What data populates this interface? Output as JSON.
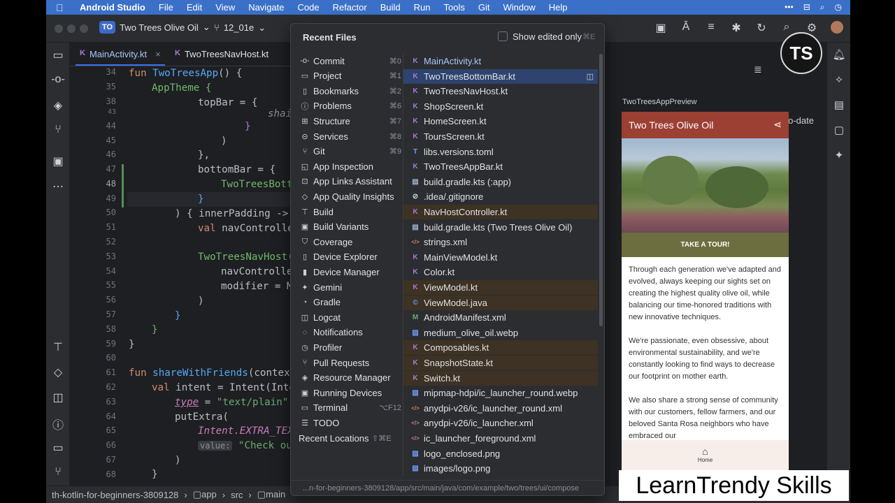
{
  "menubar": {
    "app_name": "Android Studio",
    "items": [
      "File",
      "Edit",
      "View",
      "Navigate",
      "Code",
      "Refactor",
      "Build",
      "Run",
      "Tools",
      "Git",
      "Window",
      "Help"
    ]
  },
  "titlebar": {
    "project_badge": "TO",
    "project_name": "Two Trees Olive Oil",
    "branch": "12_01e"
  },
  "editor": {
    "tabs": [
      {
        "label": "MainActivity.kt",
        "icon": "kotlin-file-icon"
      },
      {
        "label": "TwoTreesNavHost.kt",
        "icon": "kotlin-file-icon"
      }
    ],
    "line_numbers": [
      "34",
      "35",
      "38",
      "43",
      "44",
      "45",
      "46",
      "47",
      "48",
      "49",
      "50",
      "51",
      "52",
      "53",
      "54",
      "55",
      "56",
      "57",
      "58",
      "59",
      "60",
      "61",
      "62",
      "63",
      "64",
      "65",
      "66",
      "67",
      "68"
    ],
    "code": {
      "l34_kw": "fun ",
      "l34_fn": "TwoTreesApp",
      "l34_rest": "() {",
      "l35": "AppTheme {",
      "l38": "topBar = {",
      "l43": "shai",
      "l44": "}",
      "l45": ")",
      "l46": "},",
      "l47": "bottomBar = {",
      "l48": "TwoTreesBott",
      "l49": "}",
      "l50": ") { innerPadding ->",
      "l51_kw": "val ",
      "l51_rest": "navControlle",
      "l53": "TwoTreesNavHost(",
      "l54": "navControlle",
      "l55": "modifier = M",
      "l56": ")",
      "l57": "}",
      "l58": "}",
      "l59": "}",
      "l61_kw": "fun ",
      "l61_fn": "shareWithFriends",
      "l61_rest": "(context",
      "l62_kw": "val ",
      "l62_rest": "intent = Intent(Inte",
      "l63_type": "type",
      "l63_eq": " = ",
      "l63_str": "\"text/plain\"",
      "l64": "putExtra(",
      "l65": "Intent.EXTRA_TEX",
      "l66_hint": "value:",
      "l66_str": " \"Check out",
      "l67": ")",
      "l68": "}"
    }
  },
  "popup": {
    "title": "Recent Files",
    "show_edited_label": "Show edited only",
    "show_edited_hint": "⌘E",
    "tool_windows": [
      {
        "label": "Commit",
        "shortcut": "⌘0",
        "icon": "commit-icon"
      },
      {
        "label": "Project",
        "shortcut": "⌘1",
        "icon": "folder-icon"
      },
      {
        "label": "Bookmarks",
        "shortcut": "⌘2",
        "icon": "bookmark-icon"
      },
      {
        "label": "Problems",
        "shortcut": "⌘6",
        "icon": "problems-icon"
      },
      {
        "label": "Structure",
        "shortcut": "⌘7",
        "icon": "structure-icon"
      },
      {
        "label": "Services",
        "shortcut": "⌘8",
        "icon": "services-icon"
      },
      {
        "label": "Git",
        "shortcut": "⌘9",
        "icon": "git-icon"
      },
      {
        "label": "App Inspection",
        "shortcut": "",
        "icon": "app-inspection-icon"
      },
      {
        "label": "App Links Assistant",
        "shortcut": "",
        "icon": "link-icon"
      },
      {
        "label": "App Quality Insights",
        "shortcut": "",
        "icon": "diamond-icon"
      },
      {
        "label": "Build",
        "shortcut": "",
        "icon": "build-icon"
      },
      {
        "label": "Build Variants",
        "shortcut": "",
        "icon": "build-variants-icon"
      },
      {
        "label": "Coverage",
        "shortcut": "",
        "icon": "shield-icon"
      },
      {
        "label": "Device Explorer",
        "shortcut": "",
        "icon": "device-icon"
      },
      {
        "label": "Device Manager",
        "shortcut": "",
        "icon": "device-manager-icon"
      },
      {
        "label": "Gemini",
        "shortcut": "",
        "icon": "sparkle-icon"
      },
      {
        "label": "Gradle",
        "shortcut": "",
        "icon": "gradle-icon"
      },
      {
        "label": "Logcat",
        "shortcut": "",
        "icon": "logcat-icon"
      },
      {
        "label": "Notifications",
        "shortcut": "",
        "icon": "bell-icon"
      },
      {
        "label": "Profiler",
        "shortcut": "",
        "icon": "profiler-icon"
      },
      {
        "label": "Pull Requests",
        "shortcut": "",
        "icon": "pull-request-icon"
      },
      {
        "label": "Resource Manager",
        "shortcut": "",
        "icon": "resource-icon"
      },
      {
        "label": "Running Devices",
        "shortcut": "",
        "icon": "running-devices-icon"
      },
      {
        "label": "Terminal",
        "shortcut": "⌥F12",
        "icon": "terminal-icon"
      },
      {
        "label": "TODO",
        "shortcut": "",
        "icon": "list-icon"
      }
    ],
    "recent_locations_label": "Recent Locations",
    "recent_locations_shortcut": "⇧⌘E",
    "files": [
      {
        "name": "MainActivity.kt",
        "type": "kt",
        "state": "current"
      },
      {
        "name": "TwoTreesBottomBar.kt",
        "type": "kt",
        "state": "selected"
      },
      {
        "name": "TwoTreesNavHost.kt",
        "type": "kt",
        "state": ""
      },
      {
        "name": "ShopScreen.kt",
        "type": "kt",
        "state": ""
      },
      {
        "name": "HomeScreen.kt",
        "type": "kt",
        "state": ""
      },
      {
        "name": "ToursScreen.kt",
        "type": "kt",
        "state": ""
      },
      {
        "name": "libs.versions.toml",
        "type": "toml",
        "state": ""
      },
      {
        "name": "TwoTreesAppBar.kt",
        "type": "kt",
        "state": ""
      },
      {
        "name": "build.gradle.kts (:app)",
        "type": "gr",
        "state": ""
      },
      {
        "name": ".idea/.gitignore",
        "type": "git",
        "state": ""
      },
      {
        "name": "NavHostController.kt",
        "type": "kt",
        "state": "modified"
      },
      {
        "name": "build.gradle.kts (Two Trees Olive Oil)",
        "type": "gr",
        "state": ""
      },
      {
        "name": "strings.xml",
        "type": "xml",
        "state": ""
      },
      {
        "name": "MainViewModel.kt",
        "type": "kt",
        "state": ""
      },
      {
        "name": "Color.kt",
        "type": "kt",
        "state": ""
      },
      {
        "name": "ViewModel.kt",
        "type": "kt",
        "state": "modified"
      },
      {
        "name": "ViewModel.java",
        "type": "java",
        "state": "modified"
      },
      {
        "name": "AndroidManifest.xml",
        "type": "man",
        "state": ""
      },
      {
        "name": "medium_olive_oil.webp",
        "type": "img",
        "state": ""
      },
      {
        "name": "Composables.kt",
        "type": "kt",
        "state": "modified"
      },
      {
        "name": "SnapshotState.kt",
        "type": "kt",
        "state": "modified"
      },
      {
        "name": "Switch.kt",
        "type": "kt",
        "state": "modified"
      },
      {
        "name": "mipmap-hdpi/ic_launcher_round.webp",
        "type": "img",
        "state": ""
      },
      {
        "name": "anydpi-v26/ic_launcher_round.xml",
        "type": "xml",
        "state": ""
      },
      {
        "name": "anydpi-v26/ic_launcher.xml",
        "type": "xml",
        "state": ""
      },
      {
        "name": "ic_launcher_foreground.xml",
        "type": "xml",
        "state": ""
      },
      {
        "name": "logo_enclosed.png",
        "type": "img",
        "state": ""
      },
      {
        "name": "images/logo.png",
        "type": "img",
        "state": ""
      }
    ],
    "path": "...n-for-beginners-3809128/app/src/main/java/com/example/two/trees/ui/compose"
  },
  "preview": {
    "status": "Up-to-date",
    "label": "TwoTreesAppPreview",
    "app_title": "Two Trees Olive Oil",
    "tour_button": "TAKE A TOUR!",
    "paragraphs": [
      "Through each generation we've adapted and evolved, always keeping our sights set on creating the highest quality olive oil, while balancing our time-honored traditions with new innovative techniques.",
      " We're passionate, even obsessive, about environmental sustainability, and we're constantly looking to find ways to decrease our footprint on mother earth.",
      " We also share a strong sense of community with our customers, fellow farmers, and our beloved Santa Rosa neighbors who have embraced our"
    ],
    "nav_home": "Home"
  },
  "statusbar": {
    "crumbs": [
      "th-kotlin-for-beginners-3809128",
      "app",
      "src",
      "main"
    ]
  },
  "overlays": {
    "watermark": "LearnTrendy Skills",
    "logo_text": "TS"
  }
}
